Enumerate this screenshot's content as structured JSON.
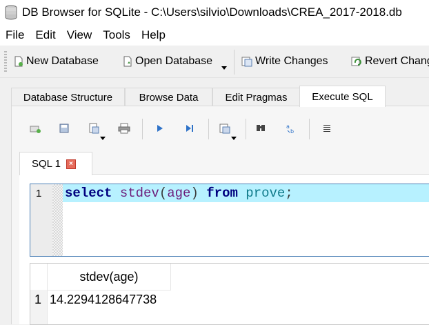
{
  "window": {
    "title": "DB Browser for SQLite - C:\\Users\\silvio\\Downloads\\CREA_2017-2018.db"
  },
  "menu": {
    "items": [
      "File",
      "Edit",
      "View",
      "Tools",
      "Help"
    ]
  },
  "toolbar": {
    "new_database": "New Database",
    "open_database": "Open Database",
    "write_changes": "Write Changes",
    "revert_changes": "Revert Changes"
  },
  "tabs": {
    "items": [
      "Database Structure",
      "Browse Data",
      "Edit Pragmas",
      "Execute SQL"
    ],
    "active": "Execute SQL"
  },
  "sql_tab": {
    "label": "SQL 1",
    "close_glyph": "×"
  },
  "editor": {
    "line_number": "1",
    "tokens": {
      "kw1": "select",
      "fn": "stdev",
      "lparen": "(",
      "arg": "age",
      "rparen": ")",
      "kw2": "from",
      "table": "prove",
      "semi": ";"
    }
  },
  "results": {
    "column_header": "stdev(age)",
    "row_number": "1",
    "value": "14.2294128647738"
  },
  "colors": {
    "current_line": "#b7f1ff",
    "keyword": "#00007f",
    "function": "#6c1b7a",
    "identifier": "#0f7a8a",
    "editor_border": "#4a7fb5"
  }
}
